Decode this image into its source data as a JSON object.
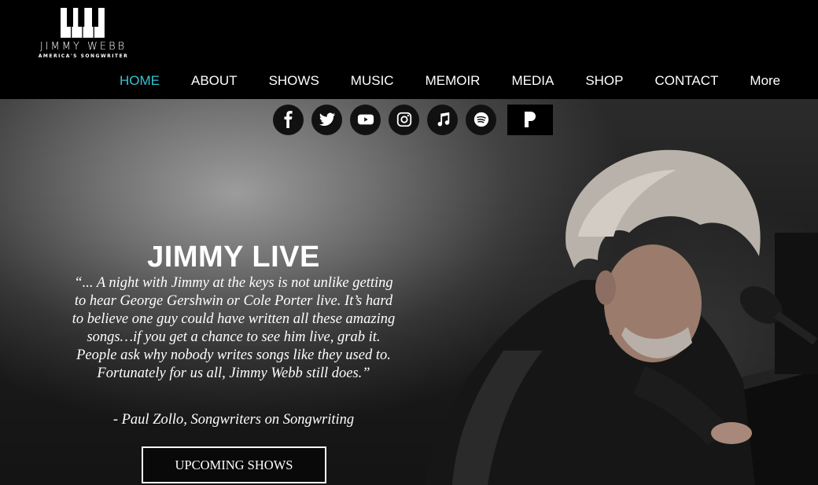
{
  "brand": {
    "name": "JIMMY WEBB",
    "tagline": "AMERICA'S SONGWRITER"
  },
  "nav": {
    "items": [
      {
        "label": "HOME",
        "active": true
      },
      {
        "label": "ABOUT"
      },
      {
        "label": "SHOWS"
      },
      {
        "label": "MUSIC"
      },
      {
        "label": "MEMOIR"
      },
      {
        "label": "MEDIA"
      },
      {
        "label": "SHOP"
      },
      {
        "label": "CONTACT"
      },
      {
        "label": "More"
      }
    ],
    "active_color": "#35c3d3"
  },
  "social": [
    {
      "icon": "facebook-icon"
    },
    {
      "icon": "twitter-icon"
    },
    {
      "icon": "youtube-icon"
    },
    {
      "icon": "instagram-icon"
    },
    {
      "icon": "apple-music-icon"
    },
    {
      "icon": "spotify-icon"
    },
    {
      "icon": "pandora-icon"
    }
  ],
  "hero": {
    "title": "JIMMY LIVE",
    "quote": "“... A night with Jimmy at the keys is not unlike getting to hear George Gershwin or Cole Porter live. It’s hard to believe one guy could have written all these amazing songs…if you get a chance to see him live, grab it. People ask why nobody writes songs like they used to. Fortunately for us all, Jimmy Webb still does.”",
    "attribution": "- Paul Zollo, Songwriters on Songwriting",
    "cta_label": "UPCOMING SHOWS"
  }
}
